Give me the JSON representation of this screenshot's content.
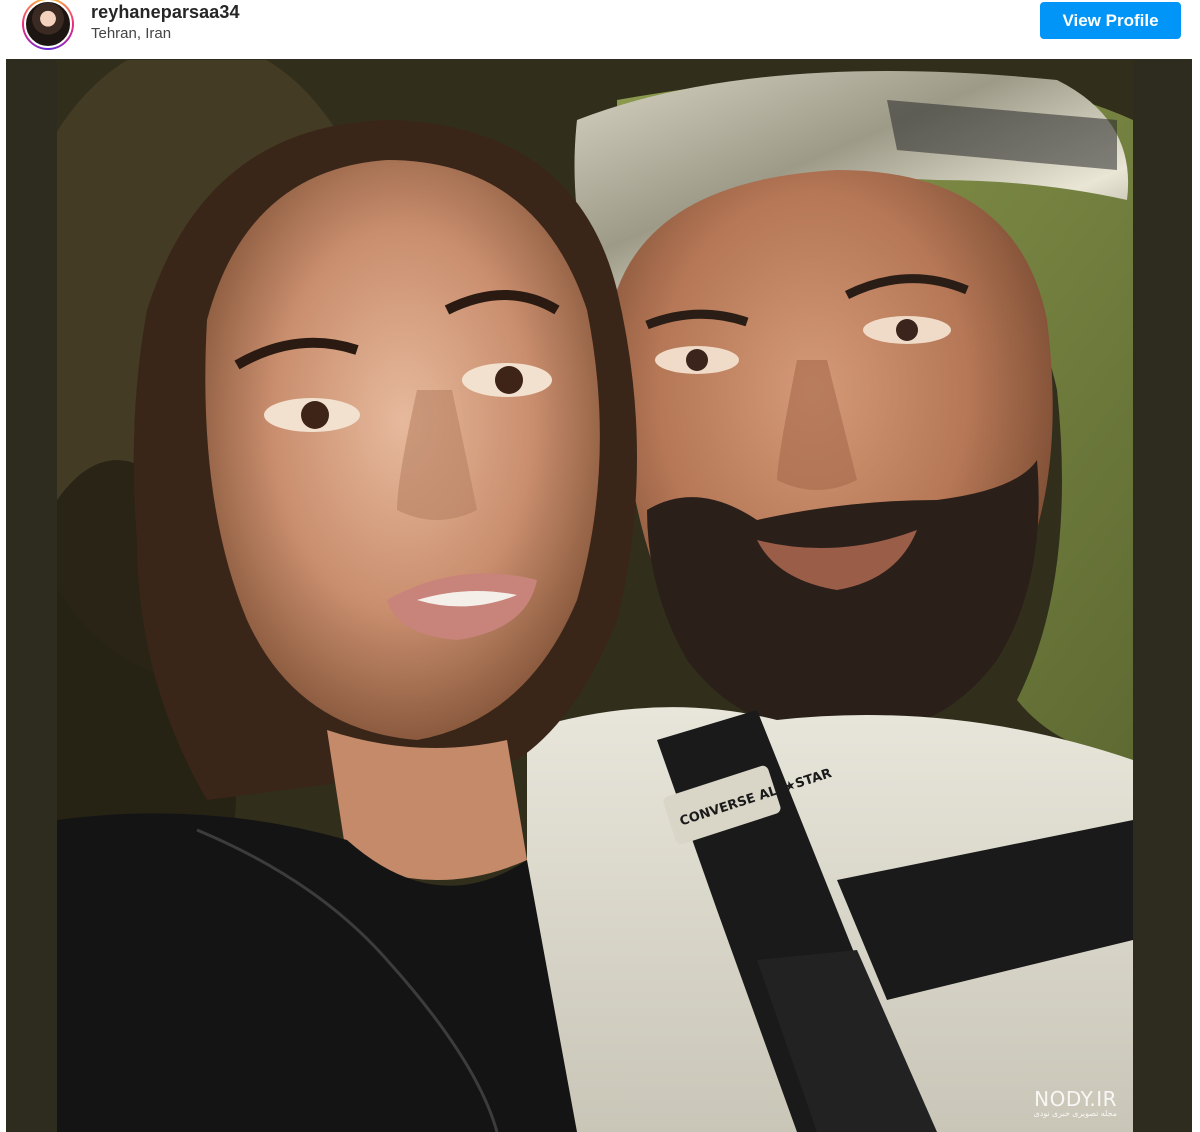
{
  "post": {
    "username": "reyhaneparsaa34",
    "location": "Tehran, Iran",
    "view_profile_label": "View Profile"
  },
  "photo": {
    "description": "selfie-photo",
    "jacket_logo_text": "CONVERSE ALL★STAR"
  },
  "watermark": {
    "main": "NODY.IR",
    "sub": "مجله تصویری خبری نودی"
  },
  "colors": {
    "button": "#0095f6",
    "photo_border": "#2e2c1e"
  }
}
